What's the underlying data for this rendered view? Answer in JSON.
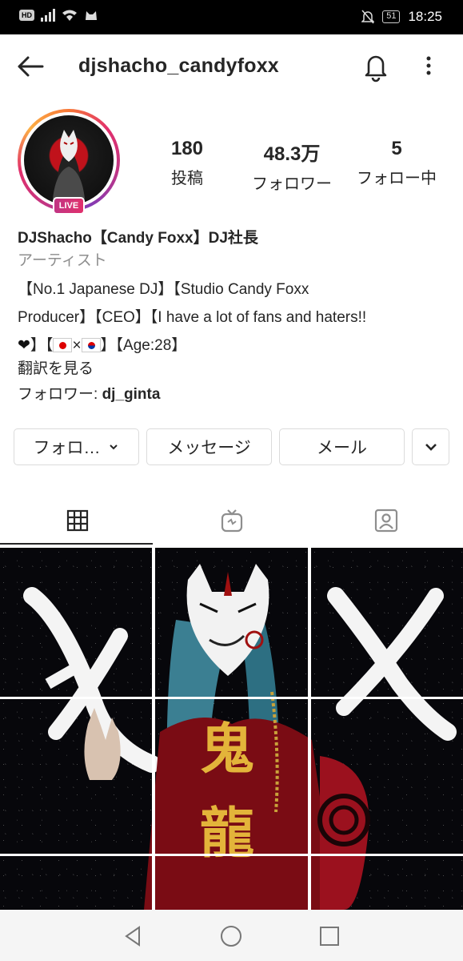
{
  "status_bar": {
    "hd": "HD",
    "battery": "51",
    "time": "18:25"
  },
  "header": {
    "username": "djshacho_candyfoxx"
  },
  "profile": {
    "live_label": "LIVE",
    "stats": [
      {
        "value": "180",
        "label": "投稿"
      },
      {
        "value": "48.3万",
        "label": "フォロワー"
      },
      {
        "value": "5",
        "label": "フォロー中"
      }
    ],
    "display_name": "DJShacho【Candy Foxx】DJ社長",
    "category": "アーティスト",
    "bio_line1": "【No.1 Japanese DJ】【Studio Candy Foxx",
    "bio_line2": "Producer】【CEO】【I have a lot of fans and haters!!",
    "bio_line3_heart": "❤",
    "bio_line3_a": "】【",
    "bio_line3_times": "×",
    "bio_line3_b": "】【Age:28】",
    "translate": "翻訳を見る",
    "followed_prefix": "フォロワー: ",
    "followed_user": "dj_ginta"
  },
  "actions": {
    "follow_label": "フォロ…",
    "message_label": "メッセージ",
    "mail_label": "メール"
  },
  "grid_art": {
    "kanji": [
      "鬼",
      "龍"
    ]
  }
}
